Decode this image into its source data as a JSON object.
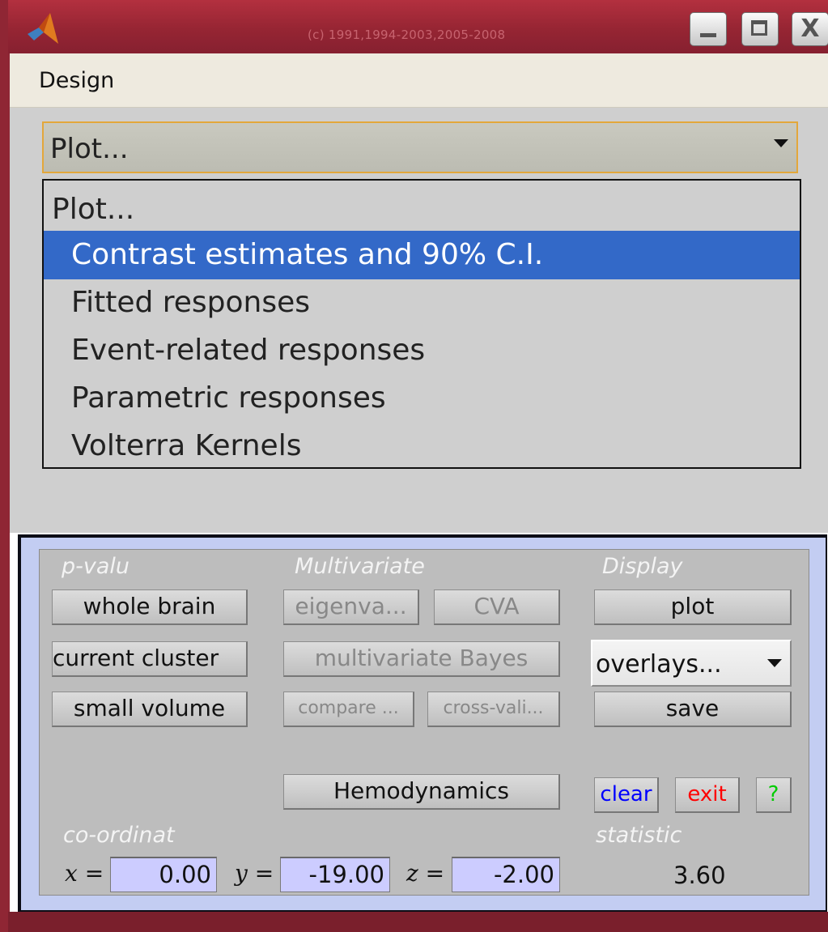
{
  "window": {
    "title": "(c) 1991,1994-2003,2005-2008",
    "controls": [
      "minimize-icon",
      "maximize-icon",
      "close-icon"
    ],
    "close_glyph": "X"
  },
  "menubar": {
    "items": [
      "Design"
    ]
  },
  "plot_select": {
    "value": "Plot...",
    "options": [
      "Plot...",
      "Contrast estimates and 90% C.I.",
      "Fitted responses",
      "Event-related responses",
      "Parametric responses",
      "Volterra Kernels"
    ],
    "highlighted_index": 1
  },
  "panel": {
    "p_value": {
      "label": "p-valu",
      "whole_brain": "whole brain",
      "current_cluster": "current cluster",
      "small_volume": "small volume"
    },
    "multivariate": {
      "label": "Multivariate",
      "eigenvariate": "eigenva...",
      "cva": "CVA",
      "multivariate_bayes": "multivariate Bayes",
      "compare": "compare ...",
      "cross_validate": "cross-vali..."
    },
    "display": {
      "label": "Display",
      "plot": "plot",
      "overlays": "overlays...",
      "save": "save"
    },
    "hemodynamics": "Hemodynamics",
    "clear": "clear",
    "exit": "exit",
    "help": "?",
    "coordinates": {
      "label": "co-ordinat",
      "x_label": "x =",
      "x": "0.00",
      "y_label": "y =",
      "y": "-19.00",
      "z_label": "z =",
      "z": "-2.00"
    },
    "statistic": {
      "label": "statistic",
      "value": "3.60"
    }
  },
  "colors": {
    "titlebar": "#962533",
    "highlight": "#3369c8",
    "clear_text": "#0000ff",
    "exit_text": "#ff0000",
    "help_text": "#00cc00",
    "coord_field": "#ccccff"
  }
}
